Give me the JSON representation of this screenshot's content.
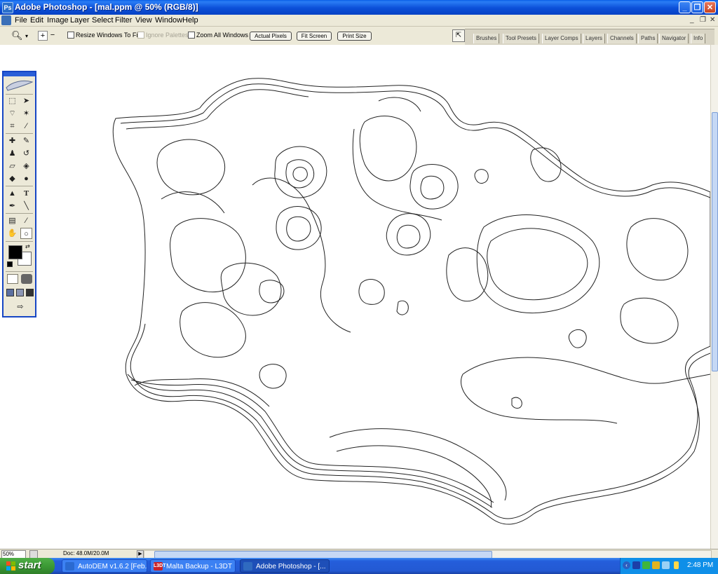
{
  "window": {
    "title": "Adobe Photoshop - [mal.ppm @ 50% (RGB/8)]",
    "buttons": {
      "minimize": "_",
      "maximize": "❐",
      "close": "✕"
    }
  },
  "menu": {
    "items": [
      "File",
      "Edit",
      "Image",
      "Layer",
      "Select",
      "Filter",
      "View",
      "Window",
      "Help"
    ],
    "doc_controls": {
      "minimize": "_",
      "restore": "❐",
      "close": "✕"
    }
  },
  "options": {
    "checkboxes": [
      {
        "label": "Resize Windows To Fit",
        "checked": false,
        "enabled": true
      },
      {
        "label": "Ignore Palettes",
        "checked": false,
        "enabled": false
      },
      {
        "label": "Zoom All Windows",
        "checked": false,
        "enabled": true
      }
    ],
    "buttons": [
      "Actual Pixels",
      "Fit Screen",
      "Print Size"
    ]
  },
  "palette_well": {
    "tabs": [
      "Brushes",
      "Tool Presets",
      "Layer Comps",
      "Layers",
      "Channels",
      "Paths",
      "Navigator",
      "Info"
    ]
  },
  "toolbox": {
    "tools": [
      "marquee",
      "move",
      "lasso",
      "magic-wand",
      "crop",
      "slice",
      "healing",
      "brush",
      "stamp",
      "history-brush",
      "eraser",
      "paint-bucket",
      "blur",
      "dodge",
      "path-select",
      "type",
      "pen",
      "line",
      "notes",
      "eyedropper",
      "hand",
      "zoom"
    ],
    "colors": {
      "foreground": "#000000",
      "background": "#ffffff"
    }
  },
  "status": {
    "zoom": "50%",
    "doc": "Doc: 48.0M/20.0M"
  },
  "taskbar": {
    "start": "start",
    "tasks": [
      {
        "label": "AutoDEM v1.6.2 [Feb...",
        "icon_color": "#2a6ad1",
        "icon": ""
      },
      {
        "label": "Malta Backup - L3DT",
        "icon_color": "#c8232a",
        "icon": "L3DT"
      },
      {
        "label": "Adobe Photoshop - [...",
        "icon_color": "#2f6ac0",
        "icon": "",
        "active": true
      }
    ],
    "clock": "2:48 PM"
  }
}
